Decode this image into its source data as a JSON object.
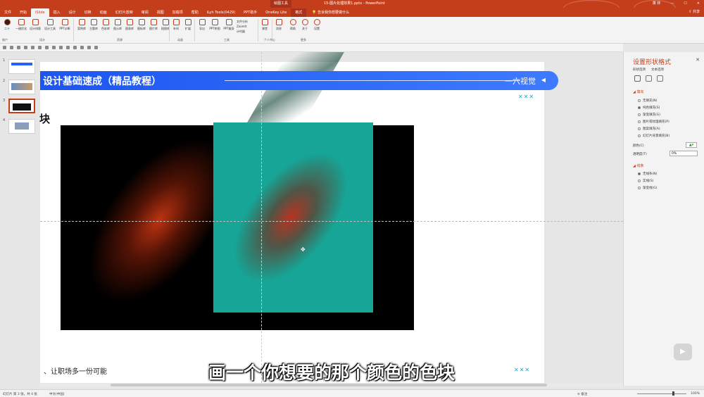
{
  "titlebar": {
    "context_tab": "绘图工具",
    "doc_title": "15-图片处理效果1.pptx  -  PowerPoint",
    "user": "萧 林",
    "share": "共享"
  },
  "tabs": [
    "文件",
    "开始",
    "iSlide",
    "插入",
    "设计",
    "切换",
    "动画",
    "幻灯片放映",
    "审阅",
    "视图",
    "加载项",
    "帮助",
    "iLyh Tools(0429)",
    "PPT助手",
    "OneKey Lite",
    "格式"
  ],
  "tellme": "告诉我你想要做什么",
  "ribbon": {
    "buttons": [
      "二十",
      "一键优化",
      "设计排版",
      "设计工具",
      "PPT诊断",
      "案例库",
      "主题库",
      "色彩库",
      "图示库",
      "图表库",
      "图标库",
      "图片库",
      "插图库",
      "补间",
      "扩展",
      "导出",
      "PPT拼图",
      "PPT瘦身",
      "课堂",
      "消息",
      "帮助",
      "关于",
      "设置"
    ],
    "small_list": [
      "文件分析",
      "ZoomIt",
      "计时器"
    ],
    "groups": [
      "账户",
      "设计",
      "资源",
      "动画",
      "工具",
      "个人中心",
      "更多"
    ]
  },
  "thumbs": [
    "1",
    "2",
    "3",
    "4"
  ],
  "slide": {
    "banner_title": "设计基础速成（精品教程）",
    "banner_brand": "一六视觉",
    "banner_arrow": "◀",
    "xxx_top": "✕✕✕",
    "xxx_bottom": "✕✕✕",
    "heading_fragment": "块",
    "footer_fragment": "、让职场多一份可能"
  },
  "subtitle": "画一个你想要的那个颜色的色块",
  "pane": {
    "title": "设置形状格式",
    "tabs": [
      "形状选项",
      "文本选项"
    ],
    "fill_section": "填充",
    "fill_options": [
      "无填充(N)",
      "纯色填充(S)",
      "渐变填充(G)",
      "图片或纹理填充(P)",
      "图案填充(A)",
      "幻灯片背景填充(B)"
    ],
    "color_label": "颜色(C)",
    "transparency_label": "透明度(T)",
    "transparency_value": "0%",
    "line_section": "线条",
    "line_options": [
      "无线条(N)",
      "实线(S)",
      "渐变线(G)"
    ]
  },
  "status": {
    "slide_info": "幻灯片 第 3 张，共 4 张",
    "lang": "中文(中国)",
    "notes": "备注",
    "zoom": "100%"
  },
  "colors": {
    "accent": "#c43e1c",
    "banner_blue": "#2563ff",
    "teal_block": "#16a596"
  }
}
